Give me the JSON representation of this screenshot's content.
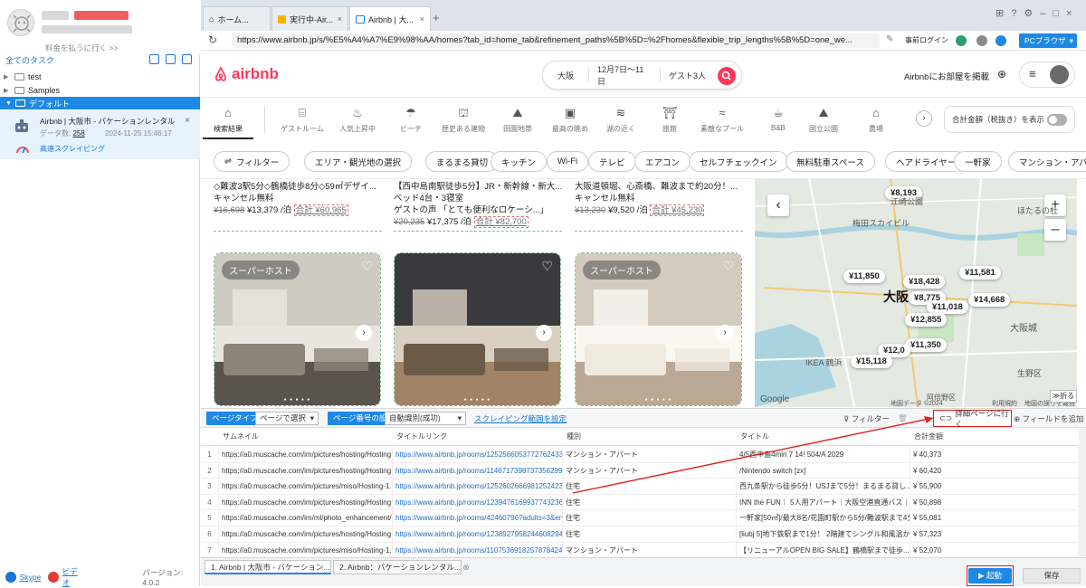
{
  "left": {
    "pay_link": "料金を払うに行く >>",
    "all_tasks": "全てのタスク",
    "tree": [
      "test",
      "Samples"
    ],
    "default_group": "デフォルト",
    "task": {
      "title": "Airbnb | 大阪市 - バケーションレンタルと…",
      "data_label": "データ数:",
      "data_count": "258",
      "date": "2024-11-25 15:46:17",
      "mode": "高速スクレイピング"
    },
    "footer": {
      "skype": "Skype",
      "video": "ビデオ",
      "version": "バージョン: 4.0.2"
    }
  },
  "tabs": [
    {
      "label": "ホーム..."
    },
    {
      "label": "実行中-Air..."
    },
    {
      "label": "Airbnb | 大..."
    }
  ],
  "url": "https://www.airbnb.jp/s/%E5%A4%A7%E9%98%AA/homes?tab_id=home_tab&refinement_paths%5B%5D=%2Fhomes&flexible_trip_lengths%5B%5D=one_we...",
  "browser_right": {
    "prelogin": "事前ログイン",
    "pc_browser": "PCブラウザ"
  },
  "airbnb": {
    "logo": "airbnb",
    "search": {
      "where": "大阪",
      "when": "12月7日〜11日",
      "guests": "ゲスト3人"
    },
    "host_link": "Airbnbにお部屋を掲載",
    "categories": [
      "検索結果",
      "ゲストルーム",
      "人気上昇中",
      "ビーチ",
      "歴史ある建物",
      "田園地帯",
      "最高の眺め",
      "湖の近く",
      "旅館",
      "素敵なプール",
      "B&B",
      "国立公園",
      "農場"
    ],
    "category_icons": [
      "home-icon",
      "bed-icon",
      "flame-icon",
      "umbrella-icon",
      "castle-icon",
      "field-icon",
      "frame-icon",
      "lake-icon",
      "inn-icon",
      "pool-icon",
      "bnb-icon",
      "park-icon",
      "farm-icon"
    ],
    "total_toggle": "合計金額（税抜き）を表示",
    "filter_btn": "フィルター",
    "chips": [
      "エリア・観光地の選択",
      "まるまる貸切",
      "キッチン",
      "Wi-Fi",
      "テレビ",
      "エアコン",
      "セルフチェックイン",
      "無料駐車スペース",
      "ヘアドライヤー",
      "一軒家",
      "マンション・アパ"
    ]
  },
  "listings_top": [
    {
      "line1": "◇難波3駅5分◇鶴橋徒歩8分◇59㎡デザイ...",
      "line2": "キャンセル無料",
      "old": "¥16,698",
      "price": "¥13,379 /泊",
      "total": "合計 ¥60,965"
    },
    {
      "line1": "【西中島南駅徒歩5分】JR・新幹線・新大...",
      "line2": "ベッド4台・3寝室",
      "line3": "ゲストの声 「とても便利なロケーシ...」",
      "old": "¥20,235",
      "price": "¥17,375 /泊",
      "total": "合計 ¥82,700"
    },
    {
      "line1": "大阪道頓堀、心斎橋、難波まで約20分！...",
      "line2": "キャンセル無料",
      "old": "¥13,230",
      "price": "¥9,520 /泊",
      "total": "合計 ¥45,230"
    }
  ],
  "listings_photos": [
    {
      "badge": "スーパーホスト"
    },
    {
      "badge": ""
    },
    {
      "badge": "スーパーホスト"
    }
  ],
  "map": {
    "pins": [
      "¥8,193",
      "¥11,850",
      "¥18,428",
      "¥11,581",
      "¥8,775",
      "¥14,668",
      "¥11,018",
      "¥12,855",
      "¥11,350",
      "¥12,0",
      "¥15,118"
    ],
    "labels": [
      "江崎公園",
      "梅田スカイビル",
      "ほたるの杜",
      "大阪",
      "大阪城",
      "IKEA 鶴浜",
      "阿倍野区",
      "生野区",
      "Google",
      "地図データ ©2024",
      "利用規約",
      "地図の誤りを報告する"
    ],
    "fold": "折る"
  },
  "tools": {
    "page_type_label": "ページタイプ",
    "page_type_value": "ページで選択",
    "page_num_label": "ページ番号の設定",
    "page_num_value": "自動識別(成功)",
    "scrape_range": "スクレイピング範囲を設定",
    "filter": "フィルター",
    "goto_detail": "詳細ページに行く",
    "add_field": "フィールドを追加"
  },
  "grid": {
    "headers": [
      "サムネイル",
      "タイトルリンク",
      "種別",
      "タイトル",
      "合計金額"
    ],
    "rows": [
      [
        "1",
        "https://a0.muscache.com/im/pictures/hosting/Hosting...",
        "https://www.airbnb.jp/rooms/12525660537727624334...",
        "マンション・アパート",
        "4/5西中島4min 7 14! 504/A 2029",
        "¥ 40,373"
      ],
      [
        "2",
        "https://a0.muscache.com/im/pictures/hosting/Hosting...",
        "https://www.airbnb.jp/rooms/11467173987373562991...",
        "マンション・アパート",
        "/Nintendo switch [zx]",
        "¥ 60,420"
      ],
      [
        "3",
        "https://a0.muscache.com/im/pictures/miso/Hosting-1...",
        "https://www.airbnb.jp/rooms/12526026669812524233...",
        "住宅",
        "西九条駅から徒歩5分！USJまで5分！まるまる貸し...",
        "¥ 55,900"
      ],
      [
        "4",
        "https://a0.muscache.com/im/pictures/hosting/Hosting...",
        "https://www.airbnb.jp/rooms/12394761699377432363...",
        "住宅",
        "INN the FUN｜ 5人用アパート｜大阪空港直通バス｜...",
        "¥ 50,898"
      ],
      [
        "5",
        "https://a0.muscache.com/im/ml/photo_enhancement/...",
        "https://www.airbnb.jp/rooms/42460796?adults=3&en...",
        "住宅",
        "一軒家[50㎡]/最大8名/花園町駅から5分/難波駅まで4分",
        "¥ 55,081"
      ],
      [
        "6",
        "https://a0.muscache.com/im/pictures/hosting/Hosting...",
        "https://www.airbnb.jp/rooms/12389279582446082941...",
        "住宅",
        "[liubj 5]地下鉄駅まで1分！ 2階建てシングル和風温か...",
        "¥ 57,323"
      ],
      [
        "7",
        "https://a0.muscache.com/im/pictures/miso/Hosting-1...",
        "https://www.airbnb.jp/rooms/11075369182578784242...",
        "マンション・アパート",
        "【リニューアルOPEN BIG SALE】鶴橋駅まで徒歩...",
        "¥ 52,070"
      ]
    ]
  },
  "bottom_tabs": [
    "1. Airbnb | 大阪市 - バケーション...",
    "2. Airbnb：バケーションレンタル..."
  ],
  "actions": {
    "start": "▶ 起動",
    "save": "保存"
  },
  "colors": {
    "accent": "#1e88e5",
    "airbnb": "#ff385c",
    "highlight": "#e02020"
  }
}
